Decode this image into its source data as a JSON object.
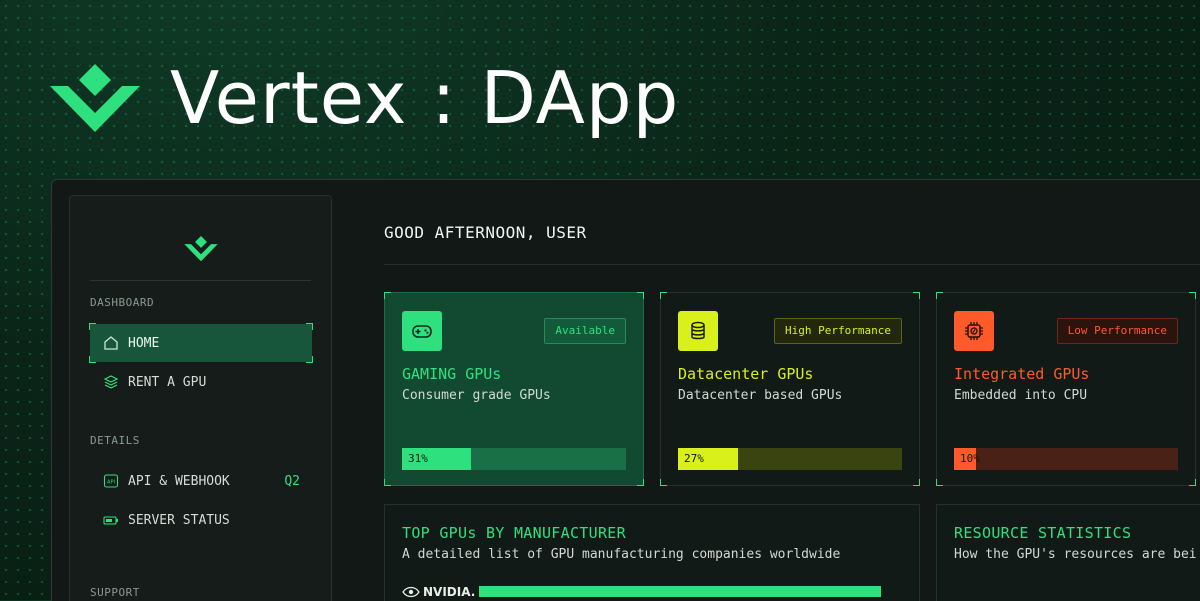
{
  "hero": {
    "title": "Vertex : DApp",
    "logo_icon": "vertex-chevron-logo-icon",
    "accent": "#2fe07e"
  },
  "sidebar": {
    "sections": [
      {
        "label": "DASHBOARD"
      },
      {
        "label": "DETAILS"
      },
      {
        "label": "SUPPORT"
      }
    ],
    "items": [
      {
        "label": "HOME",
        "icon": "home-icon",
        "active": true
      },
      {
        "label": "RENT A GPU",
        "icon": "stack-icon"
      },
      {
        "label": "API & WEBHOOK",
        "icon": "api-icon",
        "badge": "Q2"
      },
      {
        "label": "SERVER STATUS",
        "icon": "battery-icon"
      }
    ]
  },
  "main": {
    "greeting": "GOOD AFTERNOON, USER",
    "cards": [
      {
        "tag": "Available",
        "title": "GAMING GPUs",
        "subtitle": "Consumer grade GPUs",
        "percent": 31,
        "percent_label": "31%",
        "icon": "gamepad-icon",
        "color": "#2fe07e"
      },
      {
        "tag": "High Performance",
        "title": "Datacenter GPUs",
        "subtitle": "Datacenter based GPUs",
        "percent": 27,
        "percent_label": "27%",
        "icon": "database-icon",
        "color": "#d9f01b"
      },
      {
        "tag": "Low Performance",
        "title": "Integrated GPUs",
        "subtitle": "Embedded into CPU",
        "percent": 10,
        "percent_label": "10%",
        "icon": "cpu-icon",
        "color": "#ff5a2a"
      }
    ],
    "panels": [
      {
        "title": "TOP GPUs BY MANUFACTURER",
        "subtitle": "A detailed list of GPU manufacturing companies worldwide",
        "rows": [
          {
            "name": "NVIDIA."
          }
        ]
      },
      {
        "title": "RESOURCE STATISTICS",
        "subtitle": "How the GPU's resources are bei"
      }
    ]
  }
}
